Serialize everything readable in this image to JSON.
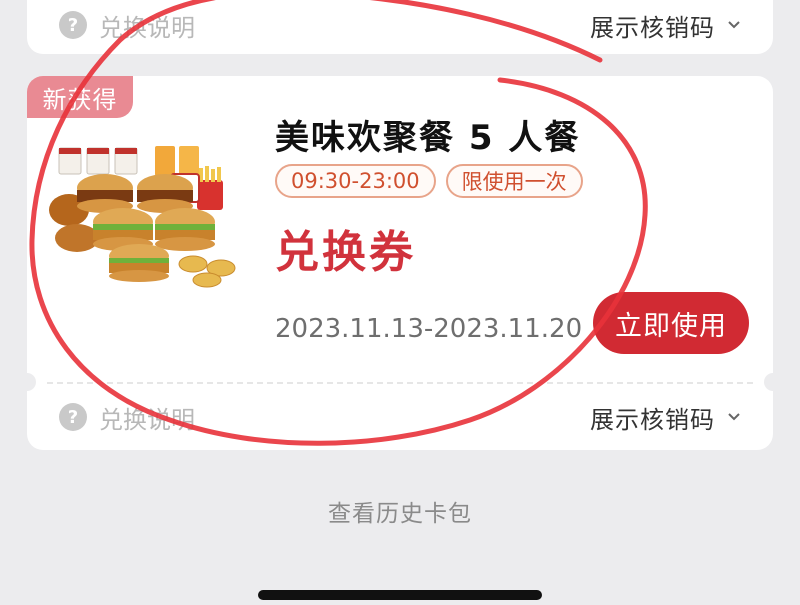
{
  "top_card": {
    "help_icon": "question-circle-icon",
    "help_label": "兑换说明",
    "show_code_label": "展示核销码"
  },
  "voucher": {
    "badge": "新获得",
    "image": "kfc-family-meal-image",
    "title": "美味欢聚餐 5 人餐",
    "tags": [
      "09:30-23:00",
      "限使用一次"
    ],
    "type_label": "兑换券",
    "validity": "2023.11.13-2023.11.20",
    "use_button": "立即使用",
    "help_icon": "question-circle-icon",
    "help_label": "兑换说明",
    "show_code_label": "展示核销码"
  },
  "history_link": "查看历史卡包",
  "colors": {
    "accent_red": "#d12a33",
    "badge_pink": "#e98a93",
    "annotation_red": "#e8323a",
    "tag_border": "#e8a48a",
    "background": "#ececee"
  }
}
